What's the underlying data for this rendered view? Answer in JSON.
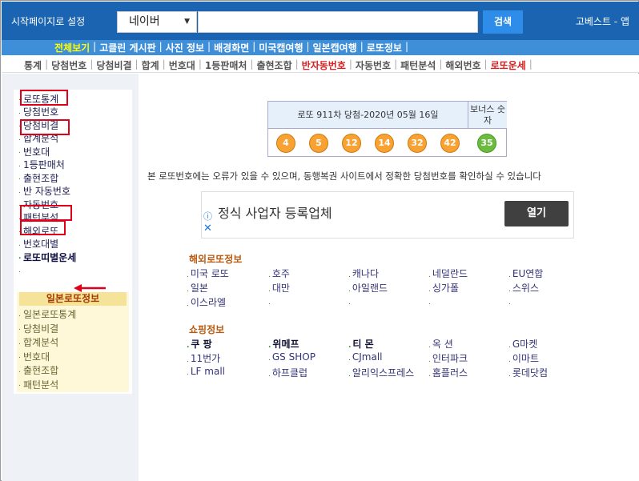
{
  "topbar": {
    "start_page": "시작페이지로 설정",
    "engine": "네이버",
    "search_button": "검색",
    "right_link": "고베스트 - 앱"
  },
  "nav1": {
    "items": [
      "전체보기",
      "고클린 게시판",
      "사진 정보",
      "배경화면",
      "미국캡여행",
      "일본캡여행",
      "로또정보"
    ]
  },
  "nav2": {
    "items": [
      "통계",
      "당첨번호",
      "당첨비결",
      "합계",
      "번호대",
      "1등판매처",
      "출현조합",
      "반자동번호",
      "자동번호",
      "패턴분석",
      "해외번호",
      "로또운세"
    ]
  },
  "sidebar": {
    "items": [
      "로또통계",
      "당첨번호",
      "당첨비결",
      "합계분석",
      "번호대",
      "1등판매처",
      "출현조합",
      "반 자동번호",
      "자동번호",
      "패턴분석",
      "해외로또",
      "번호대별",
      "로또띠별운세"
    ]
  },
  "jp_panel": {
    "title": "일본로또정보",
    "items": [
      "일본로또통계",
      "당첨비결",
      "합계분석",
      "번호대",
      "출현조합",
      "패턴분석"
    ]
  },
  "lotto": {
    "header": "로또 911차 당첨-2020년 05월 16일",
    "bonus_header": "보너스 숫자",
    "numbers": [
      "4",
      "5",
      "12",
      "14",
      "32",
      "42"
    ],
    "bonus": "35"
  },
  "notice": "본 로또번호에는 오류가 있을 수 있으며, 동행복권 사이트에서 정확한 당첨번호를 확인하실 수 있습니다",
  "ad": {
    "text": "정식 사업자 등록업체",
    "button": "열기",
    "info_icon": "info-icon",
    "close_icon": "close-icon"
  },
  "overseas": {
    "title": "해외로또정보",
    "items": [
      "미국 로또",
      "호주",
      "캐나다",
      "네덜란드",
      "EU연합",
      "일본",
      "대만",
      "아일랜드",
      "싱가폴",
      "스위스",
      "이스라엘"
    ]
  },
  "shopping": {
    "title": "쇼핑정보",
    "items": [
      "쿠 팡",
      "위메프",
      "티 몬",
      "옥 션",
      "G마켓",
      "11번가",
      "GS SHOP",
      "CJmall",
      "인터파크",
      "이마트",
      "LF mall",
      "하프클럽",
      "알리익스프레스",
      "홈플러스",
      "롯데닷컴"
    ]
  },
  "colors": {
    "topbar": "#1a64b2",
    "highlight_box": "#e0001a",
    "ball": "#f7a233",
    "bonus_ball": "#6bbb40"
  }
}
